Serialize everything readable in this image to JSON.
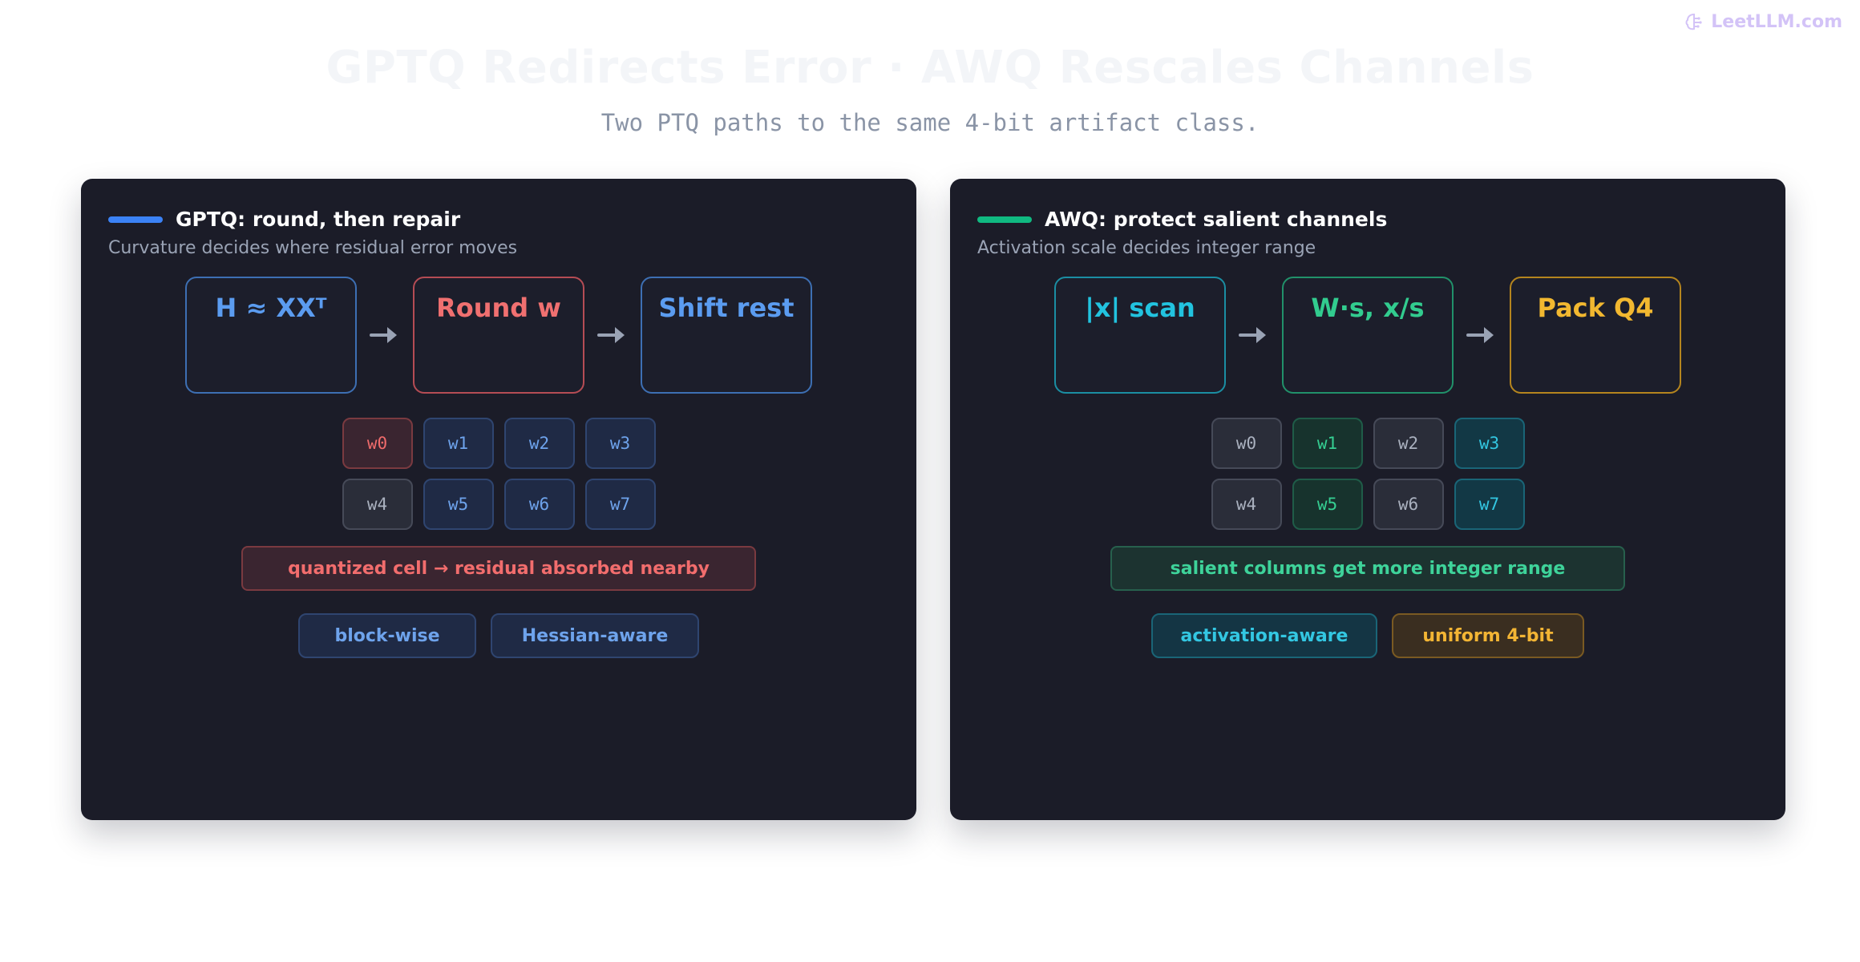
{
  "brand": {
    "label": "LeetLLM.com",
    "icon": "brain-icon",
    "color": "#d3c3f7"
  },
  "header": {
    "title": "GPTQ Redirects Error · AWQ Rescales Channels",
    "subtitle": "Two PTQ paths to the same 4-bit artifact class."
  },
  "panels": [
    {
      "key": "gptq",
      "accent": "#3b82f6",
      "title": "GPTQ: round, then repair",
      "desc": "Curvature decides where residual error moves",
      "stages": [
        {
          "label": "H ≈ XXᵀ",
          "color": "#5b9cf0"
        },
        {
          "label": "Round w",
          "color": "#f07070"
        },
        {
          "label": "Shift rest",
          "color": "#5b9cf0"
        }
      ],
      "cells": [
        [
          "w0",
          "w1",
          "w2",
          "w3"
        ],
        [
          "w4",
          "w5",
          "w6",
          "w7"
        ]
      ],
      "note": "quantized cell → residual absorbed nearby",
      "tags": [
        "block-wise",
        "Hessian-aware"
      ]
    },
    {
      "key": "awq",
      "accent": "#10b981",
      "title": "AWQ: protect salient channels",
      "desc": "Activation scale decides integer range",
      "stages": [
        {
          "label": "|x| scan",
          "color": "#22c3df"
        },
        {
          "label": "W·s, x/s",
          "color": "#32cc8f"
        },
        {
          "label": "Pack Q4",
          "color": "#f2b830"
        }
      ],
      "cells": [
        [
          "w0",
          "w1",
          "w2",
          "w3"
        ],
        [
          "w4",
          "w5",
          "w6",
          "w7"
        ]
      ],
      "note": "salient columns get more integer range",
      "tags": [
        "activation-aware",
        "uniform 4-bit"
      ]
    }
  ]
}
